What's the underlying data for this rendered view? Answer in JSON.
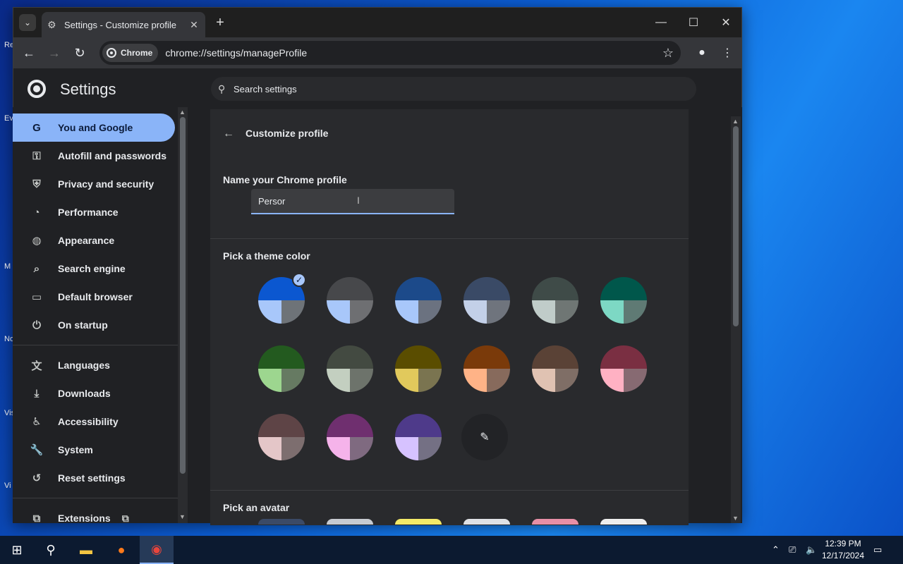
{
  "desktop": {
    "icon_labels": [
      "Re",
      "Ev",
      "M",
      "No",
      "Vis",
      "Vi"
    ]
  },
  "browser": {
    "tab_title": "Settings - Customize profile",
    "new_tab_symbol": "+",
    "window_controls": {
      "minimize": "—",
      "maximize": "☐",
      "close": "✕"
    },
    "security_chip": "Chrome",
    "url": "chrome://settings/manageProfile"
  },
  "settings": {
    "title": "Settings",
    "search_placeholder": "Search settings",
    "nav": [
      {
        "label": "You and Google",
        "icon": "google-icon",
        "glyph": "G",
        "active": true
      },
      {
        "label": "Autofill and passwords",
        "icon": "key-icon",
        "glyph": "⚿"
      },
      {
        "label": "Privacy and security",
        "icon": "shield-icon",
        "glyph": "⛨"
      },
      {
        "label": "Performance",
        "icon": "speedometer-icon",
        "glyph": "◔"
      },
      {
        "label": "Appearance",
        "icon": "palette-icon",
        "glyph": "◍"
      },
      {
        "label": "Search engine",
        "icon": "search-icon",
        "glyph": "⌕"
      },
      {
        "label": "Default browser",
        "icon": "browser-icon",
        "glyph": "▭"
      },
      {
        "label": "On startup",
        "icon": "power-icon",
        "glyph": "⏻"
      },
      {
        "label": "Languages",
        "icon": "translate-icon",
        "glyph": "文"
      },
      {
        "label": "Downloads",
        "icon": "download-icon",
        "glyph": "⤓"
      },
      {
        "label": "Accessibility",
        "icon": "accessibility-icon",
        "glyph": "♿"
      },
      {
        "label": "System",
        "icon": "wrench-icon",
        "glyph": "🔧"
      },
      {
        "label": "Reset settings",
        "icon": "reset-icon",
        "glyph": "↺"
      },
      {
        "label": "Extensions",
        "icon": "puzzle-icon",
        "glyph": "⧉"
      }
    ]
  },
  "customize": {
    "page_title": "Customize profile",
    "name_label": "Name your Chrome profile",
    "name_value": "Persor",
    "theme_label": "Pick a theme color",
    "avatar_label": "Pick an avatar",
    "selected_theme_index": 0,
    "themes": [
      {
        "top": "#0b57d0",
        "bl": "#a8c7fa",
        "br": "#6e7378"
      },
      {
        "top": "#47484b",
        "bl": "#a8c7fa",
        "br": "#6e6f72"
      },
      {
        "top": "#1c4a8a",
        "bl": "#a8c7fa",
        "br": "#6b7280"
      },
      {
        "top": "#3a4a66",
        "bl": "#c3d0e8",
        "br": "#6f747d"
      },
      {
        "top": "#3f4b48",
        "bl": "#c0ccc9",
        "br": "#6f7674"
      },
      {
        "top": "#00574b",
        "bl": "#7dd8c4",
        "br": "#5f7a74"
      },
      {
        "top": "#235a1f",
        "bl": "#9dd68f",
        "br": "#667a62"
      },
      {
        "top": "#434a41",
        "bl": "#c3cfc0",
        "br": "#6d736b"
      },
      {
        "top": "#5a4d00",
        "bl": "#e1c95c",
        "br": "#7a7450"
      },
      {
        "top": "#7a3a0a",
        "bl": "#ffb387",
        "br": "#876a5c"
      },
      {
        "top": "#5a4236",
        "bl": "#e0c2b2",
        "br": "#7f6e66"
      },
      {
        "top": "#7a2f42",
        "bl": "#ffb1c3",
        "br": "#876a72"
      },
      {
        "top": "#5e4446",
        "bl": "#e4c6c8",
        "br": "#7d6e6f"
      },
      {
        "top": "#6f2f6f",
        "bl": "#f5b3ea",
        "br": "#7f6a80"
      },
      {
        "top": "#4e3a8a",
        "bl": "#d6c2ff",
        "br": "#747084"
      }
    ],
    "avatar_peek_colors": [
      "#3b4a66",
      "#c7cbd1",
      "#f4ea68",
      "#dfe1e5",
      "#e78fa6",
      "#eeeeee"
    ]
  },
  "taskbar": {
    "time": "12:39 PM",
    "date": "12/17/2024"
  }
}
